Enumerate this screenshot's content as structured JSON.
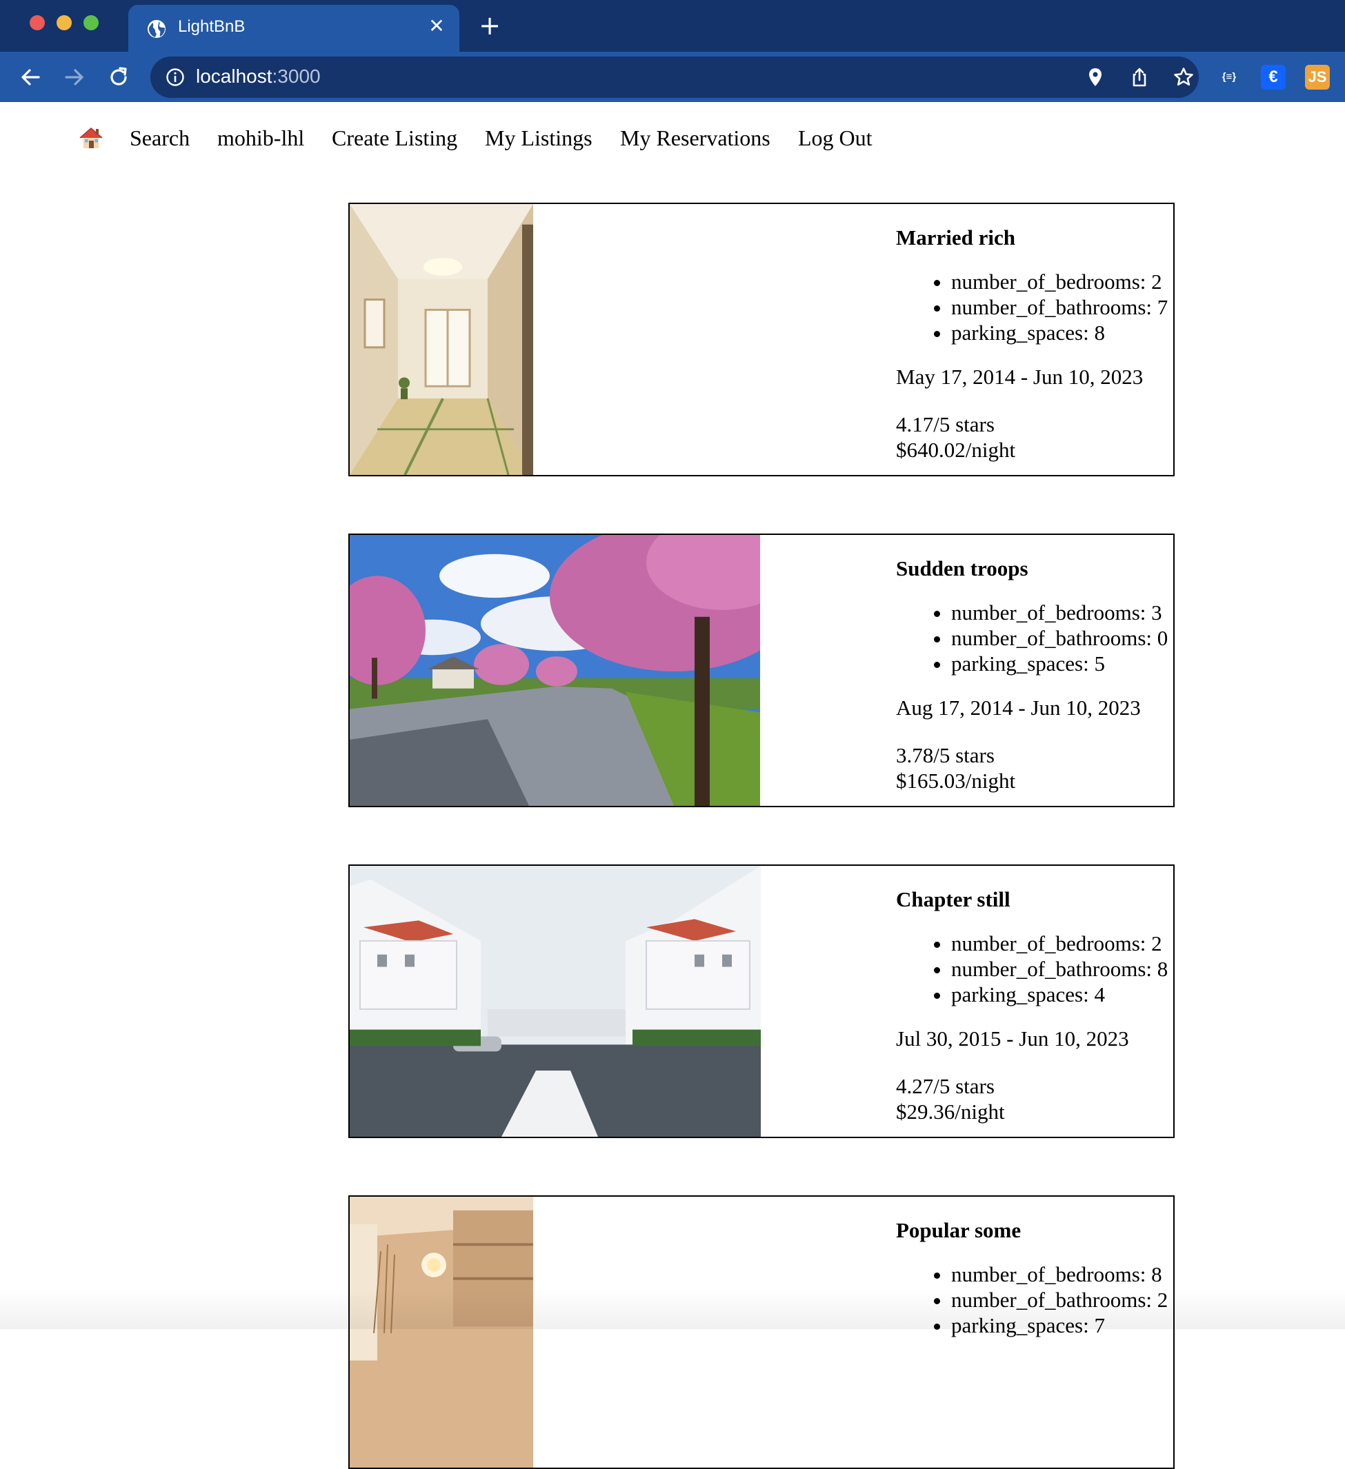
{
  "browser": {
    "tab_title": "LightBnB",
    "url_host": "localhost",
    "url_port": ":3000",
    "extensions": {
      "json": "{≡}",
      "euro": "€",
      "js": "JS"
    }
  },
  "nav": {
    "home_icon": "house-emoji",
    "search": "Search",
    "user": "mohib-lhl",
    "create_listing": "Create Listing",
    "my_listings": "My Listings",
    "my_reservations": "My Reservations",
    "log_out": "Log Out"
  },
  "listings": [
    {
      "title": "Married rich",
      "bedrooms": "number_of_bedrooms: 2",
      "bathrooms": "number_of_bathrooms: 7",
      "parking": "parking_spaces: 8",
      "dates": "May 17, 2014 - Jun 10, 2023",
      "rating": "4.17/5 stars",
      "price": "$640.02/night"
    },
    {
      "title": "Sudden troops",
      "bedrooms": "number_of_bedrooms: 3",
      "bathrooms": "number_of_bathrooms: 0",
      "parking": "parking_spaces: 5",
      "dates": "Aug 17, 2014 - Jun 10, 2023",
      "rating": "3.78/5 stars",
      "price": "$165.03/night"
    },
    {
      "title": "Chapter still",
      "bedrooms": "number_of_bedrooms: 2",
      "bathrooms": "number_of_bathrooms: 8",
      "parking": "parking_spaces: 4",
      "dates": "Jul 30, 2015 - Jun 10, 2023",
      "rating": "4.27/5 stars",
      "price": "$29.36/night"
    },
    {
      "title": "Popular some",
      "bedrooms": "number_of_bedrooms: 8",
      "bathrooms": "number_of_bathrooms: 2",
      "parking": "parking_spaces: 7",
      "dates": "",
      "rating": "",
      "price": ""
    }
  ]
}
